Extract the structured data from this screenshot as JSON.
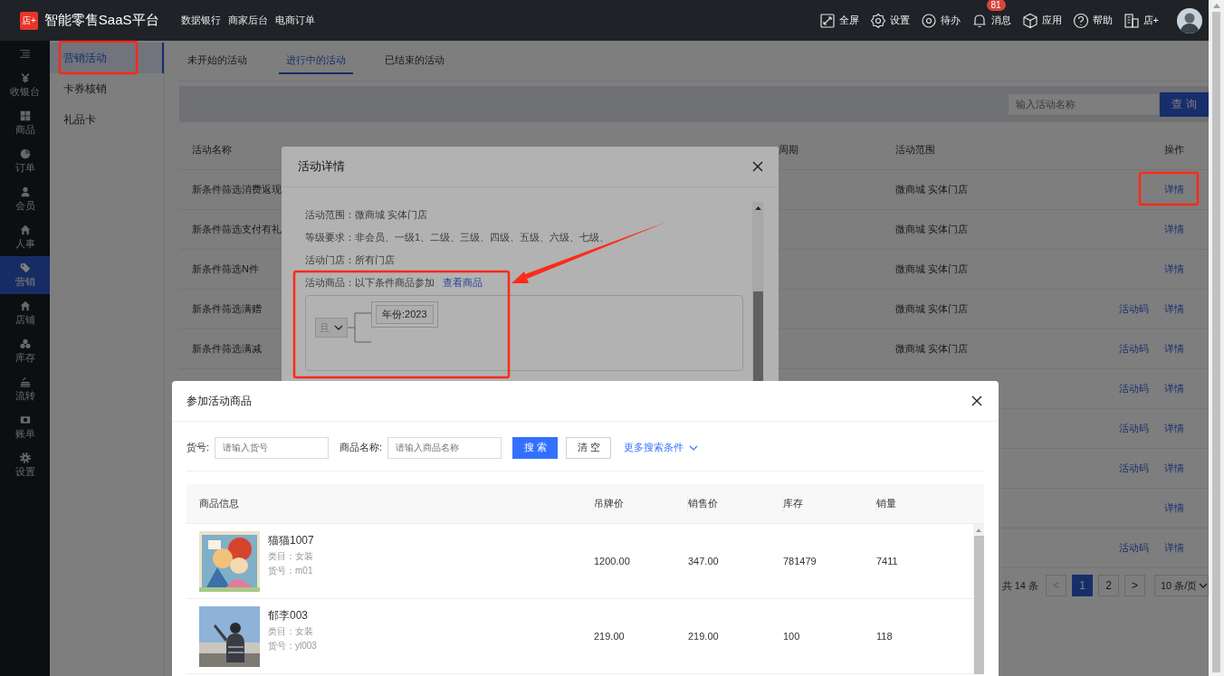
{
  "header": {
    "logo": "店+",
    "title": "智能零售SaaS平台",
    "nav": [
      {
        "label": "数据银行"
      },
      {
        "label": "商家后台"
      },
      {
        "label": "电商订单"
      }
    ],
    "tools": [
      {
        "label": "全屏"
      },
      {
        "label": "设置"
      },
      {
        "label": "待办"
      },
      {
        "label": "消息",
        "badge": "81"
      },
      {
        "label": "应用"
      },
      {
        "label": "帮助"
      },
      {
        "label": "店+"
      }
    ]
  },
  "rail": {
    "items": [
      {
        "label": "收银台",
        "selected": false
      },
      {
        "label": "商品",
        "selected": false
      },
      {
        "label": "订单",
        "selected": false
      },
      {
        "label": "会员",
        "selected": false
      },
      {
        "label": "人事",
        "selected": false
      },
      {
        "label": "营销",
        "selected": true
      },
      {
        "label": "店铺",
        "selected": false
      },
      {
        "label": "库存",
        "selected": false
      },
      {
        "label": "流转",
        "selected": false
      },
      {
        "label": "账单",
        "selected": false
      },
      {
        "label": "设置",
        "selected": false
      }
    ]
  },
  "submenu": {
    "items": [
      {
        "label": "营销活动",
        "selected": true
      },
      {
        "label": "卡券核销",
        "selected": false
      },
      {
        "label": "礼品卡",
        "selected": false
      }
    ]
  },
  "tabs": [
    {
      "label": "未开始的活动",
      "selected": false
    },
    {
      "label": "进行中的活动",
      "selected": true
    },
    {
      "label": "已结束的活动",
      "selected": false
    }
  ],
  "search": {
    "placeholder": "输入活动名称",
    "button": "查 询"
  },
  "table": {
    "columns": [
      "活动名称",
      "周期",
      "活动范围",
      "操作"
    ],
    "rows": [
      {
        "name": "新条件筛选消费返现",
        "scope": "微商城 实体门店",
        "actions": [
          "详情"
        ]
      },
      {
        "name": "新条件筛选支付有礼",
        "scope": "微商城 实体门店",
        "actions": [
          "详情"
        ]
      },
      {
        "name": "新条件筛选N件",
        "scope": "微商城 实体门店",
        "actions": [
          "详情"
        ]
      },
      {
        "name": "新条件筛选满赠",
        "scope": "微商城 实体门店",
        "actions": [
          "活动码",
          "详情"
        ]
      },
      {
        "name": "新条件筛选满减",
        "scope": "微商城 实体门店",
        "actions": [
          "活动码",
          "详情"
        ]
      },
      {
        "actions": [
          "活动码",
          "详情"
        ]
      },
      {
        "actions": [
          "活动码",
          "详情"
        ]
      },
      {
        "actions": [
          "活动码",
          "详情"
        ]
      },
      {
        "actions": [
          "详情"
        ]
      },
      {
        "actions": [
          "活动码",
          "详情"
        ]
      }
    ]
  },
  "pagination": {
    "total": "共 14 条",
    "prev": "<",
    "pages": [
      {
        "label": "1",
        "selected": true
      },
      {
        "label": "2",
        "selected": false
      }
    ],
    "next": ">",
    "page_size": "10 条/页"
  },
  "detail_dialog": {
    "title": "活动详情",
    "lines": [
      "活动范围：微商城 实体门店",
      "等级要求：非会员、一级1、二级、三级、四级、五级、六级、七级、",
      "活动门店：所有门店"
    ],
    "goods": {
      "text": "活动商品：以下条件商品参加",
      "link": "查看商品",
      "operator": {
        "label": "且",
        "disabled": true
      },
      "conditions": [
        "年份:2023"
      ]
    }
  },
  "goods_dialog": {
    "title": "参加活动商品",
    "filters": [
      {
        "label": "货号:",
        "placeholder": "请输入货号"
      },
      {
        "label": "商品名称:",
        "placeholder": "请输入商品名称"
      }
    ],
    "search_button": "搜 索",
    "clear_button": "清 空",
    "more": "更多搜索条件",
    "columns": [
      "商品信息",
      "吊牌价",
      "销售价",
      "库存",
      "销量"
    ],
    "rows": [
      {
        "name": "猫猫1007",
        "category": "类目：女装",
        "sku": "货号：m01",
        "tag_price": "1200.00",
        "sale_price": "347.00",
        "stock": "781479",
        "sales": "7411"
      },
      {
        "name": "郁李003",
        "category": "类目：女装",
        "sku": "货号：yl003",
        "tag_price": "219.00",
        "sale_price": "219.00",
        "stock": "100",
        "sales": "118"
      }
    ]
  }
}
